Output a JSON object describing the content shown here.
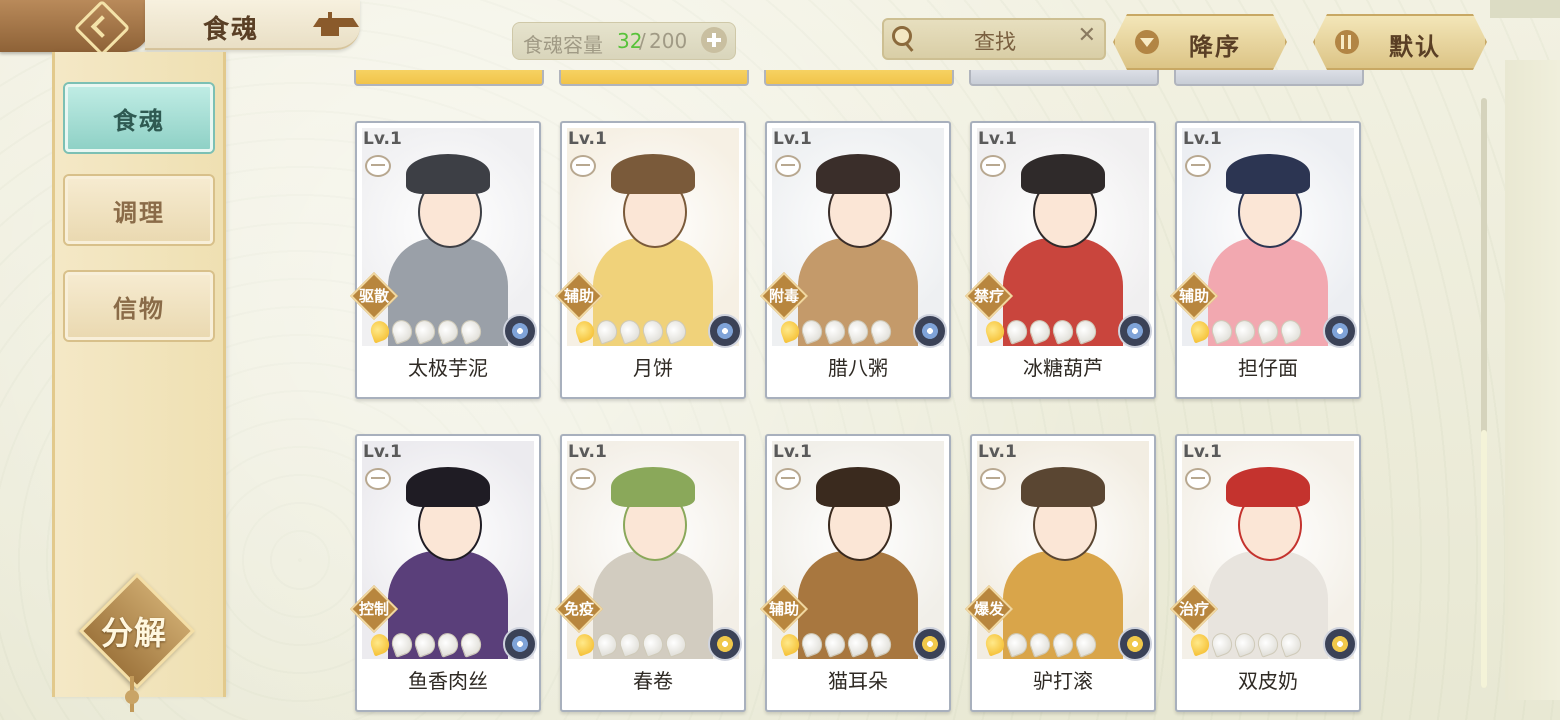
{
  "header": {
    "title": "食魂",
    "capacity_label": "食魂容量",
    "capacity_current": "32",
    "capacity_max": "200",
    "search_text": "查找",
    "sort_order_label": "降序",
    "sort_mode_label": "默认"
  },
  "sidebar": {
    "tabs": [
      {
        "label": "食魂",
        "active": true
      },
      {
        "label": "调理",
        "active": false
      },
      {
        "label": "信物",
        "active": false
      }
    ],
    "decompose_label": "分解"
  },
  "cards": [
    {
      "level": "Lv.1",
      "name": "太极芋泥",
      "role": "驱散",
      "stars_filled": 1,
      "stars_total": 5,
      "element": "blue-flower"
    },
    {
      "level": "Lv.1",
      "name": "月饼",
      "role": "辅助",
      "stars_filled": 1,
      "stars_total": 5,
      "element": "blue-flower"
    },
    {
      "level": "Lv.1",
      "name": "腊八粥",
      "role": "附毒",
      "stars_filled": 1,
      "stars_total": 5,
      "element": "blue-flower"
    },
    {
      "level": "Lv.1",
      "name": "冰糖葫芦",
      "role": "禁疗",
      "stars_filled": 1,
      "stars_total": 5,
      "element": "blue-flower"
    },
    {
      "level": "Lv.1",
      "name": "担仔面",
      "role": "辅助",
      "stars_filled": 1,
      "stars_total": 5,
      "element": "blue-flower"
    },
    {
      "level": "Lv.1",
      "name": "鱼香肉丝",
      "role": "控制",
      "stars_filled": 1,
      "stars_total": 5,
      "element": "blue-flower"
    },
    {
      "level": "Lv.1",
      "name": "春卷",
      "role": "免疫",
      "stars_filled": 1,
      "stars_total": 5,
      "element": "gold-flower"
    },
    {
      "level": "Lv.1",
      "name": "猫耳朵",
      "role": "辅助",
      "stars_filled": 1,
      "stars_total": 5,
      "element": "gold-flower"
    },
    {
      "level": "Lv.1",
      "name": "驴打滚",
      "role": "爆发",
      "stars_filled": 1,
      "stars_total": 5,
      "element": "gold-flower"
    },
    {
      "level": "Lv.1",
      "name": "双皮奶",
      "role": "治疗",
      "stars_filled": 1,
      "stars_total": 5,
      "element": "gold-flower"
    }
  ],
  "colors": {
    "accent_gold": "#dcc486",
    "active_tab": "#8fd1c6",
    "capacity_current": "#57c23a"
  },
  "icons": {
    "back": "back-chevron-icon",
    "title": "pavilion-icon",
    "capacity_add": "plus-icon",
    "search": "search-icon",
    "clear": "close-icon",
    "sort_order": "sort-down-icon",
    "sort_mode": "filter-icon"
  }
}
